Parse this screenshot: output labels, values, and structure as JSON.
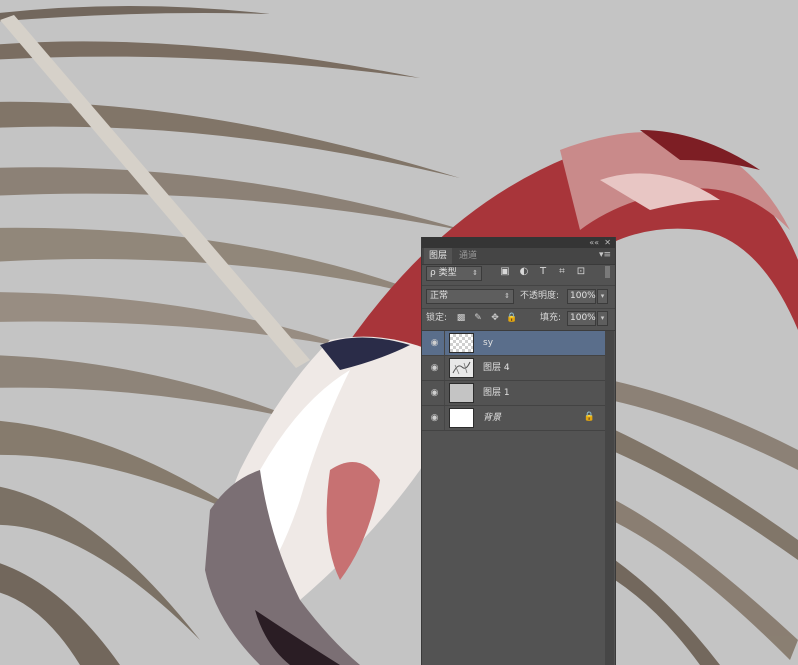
{
  "window": {
    "collapse_glyph": "««",
    "close_glyph": "✕"
  },
  "tabs": [
    {
      "label": "图层",
      "active": true
    },
    {
      "label": "通道",
      "active": false
    }
  ],
  "panel_menu_glyph": "▾≡",
  "filter": {
    "kind_label": "ρ 类型",
    "arrow": "⇕",
    "icons": [
      "image-filter-icon",
      "adjustment-filter-icon",
      "type-filter-icon",
      "shape-filter-icon",
      "smart-object-filter-icon"
    ],
    "icon_glyphs": [
      "▣",
      "◐",
      "T",
      "⌗",
      "⊡"
    ]
  },
  "blend": {
    "mode": "正常",
    "arrow": "⇕",
    "opacity_label": "不透明度:",
    "opacity_value": "100%",
    "opacity_arrow": "▾"
  },
  "lock": {
    "label": "锁定:",
    "icon_glyphs": [
      "▩",
      "✎",
      "✥",
      "🔒"
    ],
    "fill_label": "填充:",
    "fill_value": "100%",
    "fill_arrow": "▾"
  },
  "layers": [
    {
      "name": "sy",
      "thumb": "checker",
      "selected": true,
      "italic": false,
      "locked": false
    },
    {
      "name": "图层 4",
      "thumb": "sketch",
      "selected": false,
      "italic": false,
      "locked": false
    },
    {
      "name": "图层 1",
      "thumb": "gray",
      "selected": false,
      "italic": false,
      "locked": false
    },
    {
      "name": "背景",
      "thumb": "white",
      "selected": false,
      "italic": true,
      "locked": true
    }
  ],
  "eye_glyph": "◉",
  "lock_glyph": "🔒",
  "colors": {
    "canvas_bg": "#c4c4c4",
    "panel_bg": "#535353",
    "selected_row": "#5a6e8b",
    "flamingo_red": "#a8353a",
    "palm_brown": "#8a7d70"
  }
}
